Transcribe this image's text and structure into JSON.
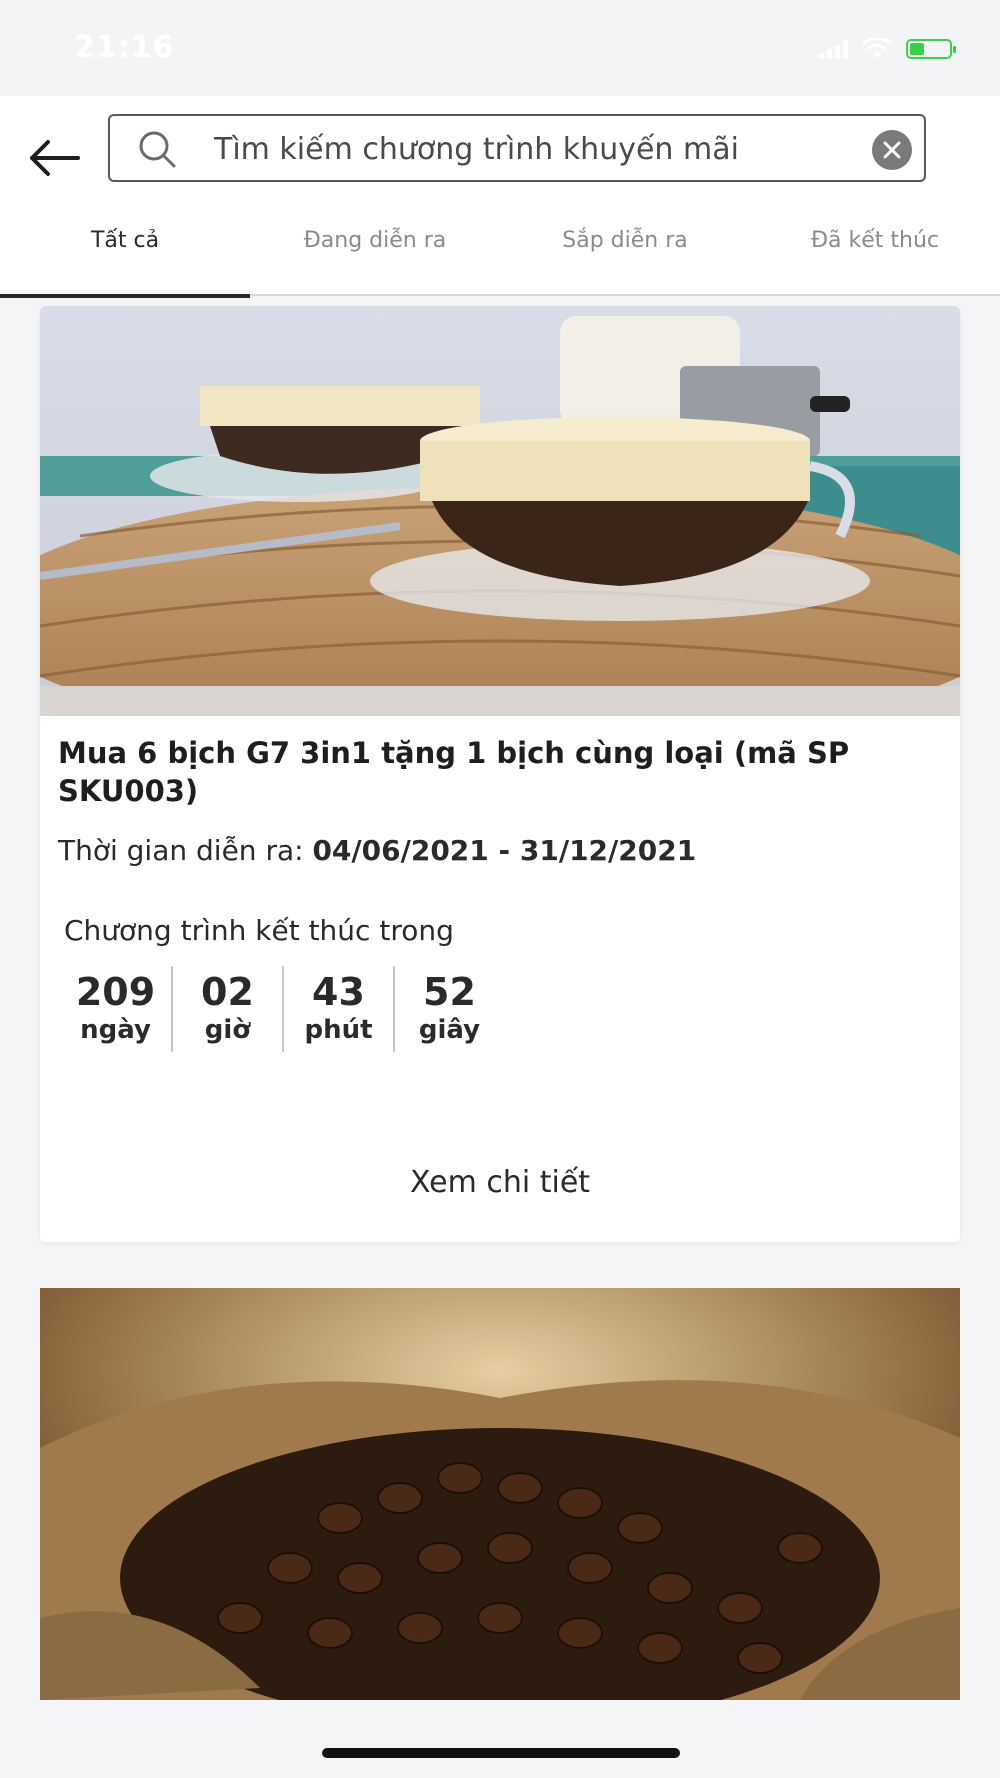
{
  "status_bar": {
    "time": "21:16"
  },
  "header": {
    "search_placeholder": "Tìm kiếm chương trình khuyến mãi"
  },
  "tabs": [
    {
      "label": "Tất cả",
      "active": true
    },
    {
      "label": "Đang diễn ra",
      "active": false
    },
    {
      "label": "Sắp diễn ra",
      "active": false
    },
    {
      "label": "Đã kết thúc",
      "active": false
    }
  ],
  "promotions": [
    {
      "title": "Mua 6 bịch G7 3in1 tặng 1 bịch cùng loại (mã SP SKU003)",
      "time_label": "Thời gian diễn ra: ",
      "time_range": "04/06/2021 - 31/12/2021",
      "countdown_label": "Chương trình kết thúc trong",
      "countdown": [
        {
          "value": "209",
          "unit": "ngày"
        },
        {
          "value": "02",
          "unit": "giờ"
        },
        {
          "value": "43",
          "unit": "phút"
        },
        {
          "value": "52",
          "unit": "giây"
        }
      ],
      "detail_label": "Xem chi tiết"
    }
  ],
  "colors": {
    "background": "#f5f5f7",
    "active_tab": "#2a2a2a",
    "inactive_tab": "#8a8a8a",
    "battery": "#3ccf4e"
  },
  "icons": [
    "back-arrow-icon",
    "search-icon",
    "clear-icon",
    "signal-icon",
    "wifi-icon",
    "battery-icon"
  ]
}
